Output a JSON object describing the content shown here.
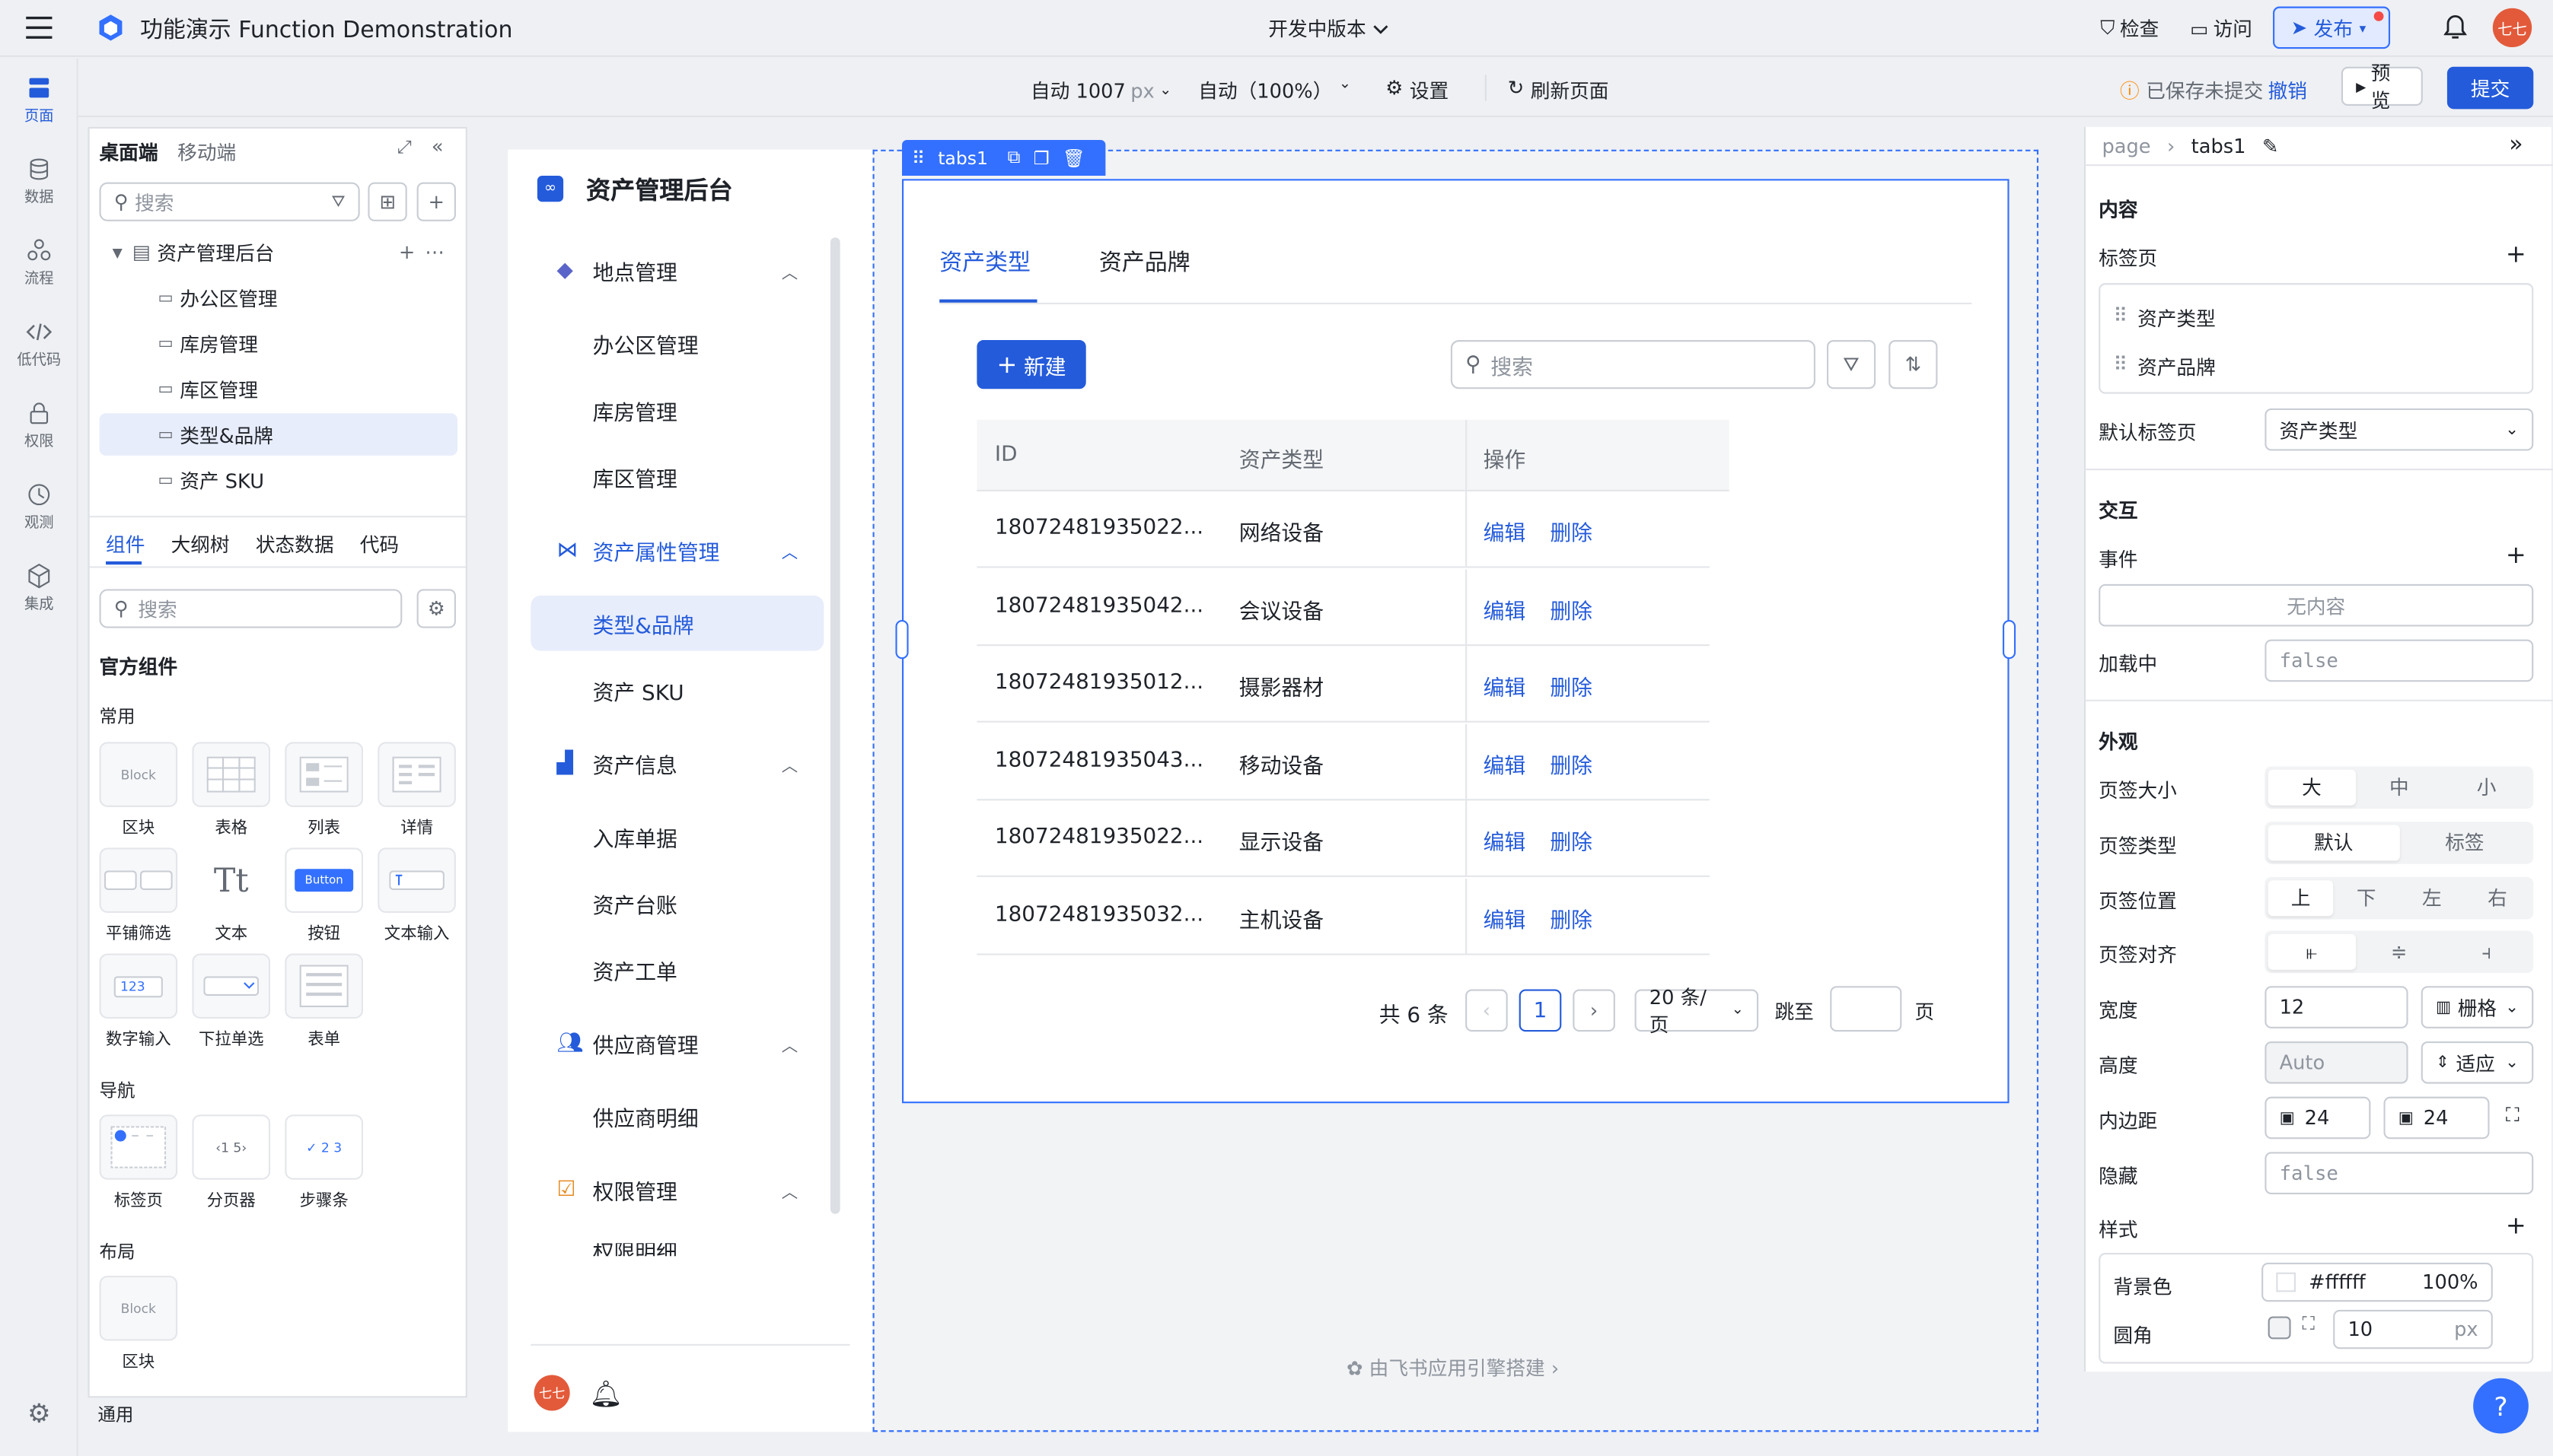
{
  "header": {
    "app_title": "功能演示 Function Demonstration",
    "env": "开发中版本",
    "check": "检查",
    "visit": "访问",
    "publish": "发布",
    "avatar": "七七"
  },
  "toolbar": {
    "width": "自动 1007",
    "width_unit": "px",
    "zoom": "自动（100%）",
    "settings": "设置",
    "refresh": "刷新页面",
    "saved_status": "已保存未提交",
    "undo": "撤销",
    "preview": "预览",
    "submit": "提交"
  },
  "rail": {
    "items": [
      "页面",
      "数据",
      "流程",
      "低代码",
      "权限",
      "观测",
      "集成"
    ]
  },
  "left_panel": {
    "tabs": [
      "桌面端",
      "移动端"
    ],
    "search_placeholder": "搜索",
    "tree_root": "资产管理后台",
    "tree_items": [
      "办公区管理",
      "库房管理",
      "库区管理",
      "类型&品牌",
      "资产 SKU"
    ],
    "bottom_tabs": [
      "组件",
      "大纲树",
      "状态数据",
      "代码"
    ],
    "comp_search_placeholder": "搜索",
    "official": "官方组件",
    "group_common": "常用",
    "common": [
      "区块",
      "表格",
      "列表",
      "详情",
      "平铺筛选",
      "文本",
      "按钮",
      "文本输入",
      "数字输入",
      "下拉单选",
      "表单"
    ],
    "group_nav": "导航",
    "nav": [
      "标签页",
      "分页器",
      "步骤条"
    ],
    "group_layout": "布局",
    "layout": [
      "区块"
    ],
    "group_general": "通用",
    "thumb_block": "Block",
    "thumb_button": "Button",
    "thumb_number": "123",
    "thumb_pager": "1 5",
    "thumb_steps": "2 3"
  },
  "app": {
    "title": "资产管理后台",
    "nav": {
      "g1": "地点管理",
      "g1_items": [
        "办公区管理",
        "库房管理",
        "库区管理"
      ],
      "g2": "资产属性管理",
      "g2_items": [
        "类型&品牌",
        "资产 SKU"
      ],
      "g3": "资产信息",
      "g3_items": [
        "入库单据",
        "资产台账",
        "资产工单"
      ],
      "g4": "供应商管理",
      "g4_items": [
        "供应商明细"
      ],
      "g5": "权限管理",
      "g5_partial": "权限明细"
    },
    "avatar": "七七",
    "footer": "由飞书应用引擎搭建",
    "tabs_tag": "tabs1",
    "tabs": [
      "资产类型",
      "资产品牌"
    ],
    "new_btn": "新建",
    "search_placeholder": "搜索",
    "columns": [
      "ID",
      "资产类型",
      "操作"
    ],
    "rows": [
      {
        "id": "18072481935022...",
        "type": "网络设备"
      },
      {
        "id": "18072481935042...",
        "type": "会议设备"
      },
      {
        "id": "18072481935012...",
        "type": "摄影器材"
      },
      {
        "id": "18072481935043...",
        "type": "移动设备"
      },
      {
        "id": "18072481935022...",
        "type": "显示设备"
      },
      {
        "id": "18072481935032...",
        "type": "主机设备"
      }
    ],
    "edit": "编辑",
    "delete": "删除",
    "total": "共 6 条",
    "page": "1",
    "page_size": "20 条/页",
    "jump": "跳至",
    "page_unit": "页"
  },
  "right_panel": {
    "crumb_page": "page",
    "crumb_current": "tabs1",
    "content": "内容",
    "tab_list_label": "标签页",
    "tab_list": [
      "资产类型",
      "资产品牌"
    ],
    "default_tab_label": "默认标签页",
    "default_tab": "资产类型",
    "interaction": "交互",
    "event": "事件",
    "event_empty": "无内容",
    "loading": "加载中",
    "loading_val": "false",
    "appearance": "外观",
    "size_label": "页签大小",
    "size_opts": [
      "大",
      "中",
      "小"
    ],
    "type_label": "页签类型",
    "type_opts": [
      "默认",
      "标签"
    ],
    "pos_label": "页签位置",
    "pos_opts": [
      "上",
      "下",
      "左",
      "右"
    ],
    "align_label": "页签对齐",
    "width_label": "宽度",
    "width_val": "12",
    "width_unit": "栅格",
    "height_label": "高度",
    "height_val": "Auto",
    "height_mode": "适应",
    "padding_label": "内边距",
    "padding_1": "24",
    "padding_2": "24",
    "hidden_label": "隐藏",
    "hidden_val": "false",
    "style": "样式",
    "bg_label": "背景色",
    "bg_val": "#ffffff",
    "bg_opacity": "100%",
    "radius_label": "圆角",
    "radius_val": "10",
    "radius_unit": "px"
  }
}
